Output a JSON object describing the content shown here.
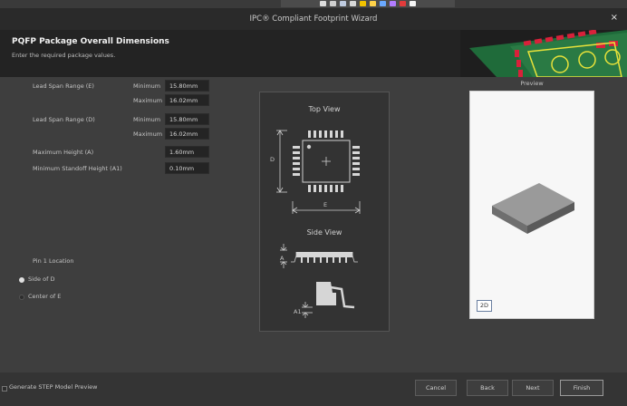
{
  "window": {
    "title": "IPC® Compliant Footprint Wizard",
    "close_label": "×"
  },
  "header": {
    "title": "PQFP Package Overall Dimensions",
    "subtitle": "Enter the required package values."
  },
  "form": {
    "lead_span_e_label": "Lead Span Range (E)",
    "lead_span_d_label": "Lead Span Range (D)",
    "minimum_label": "Minimum",
    "maximum_label": "Maximum",
    "e_min": "15.80mm",
    "e_max": "16.02mm",
    "d_min": "15.80mm",
    "d_max": "16.02mm",
    "max_height_label": "Maximum Height (A)",
    "max_height": "1.60mm",
    "min_standoff_label": "Minimum Standoff Height (A1)",
    "min_standoff": "0.10mm"
  },
  "pin1": {
    "label": "Pin 1 Location",
    "options": [
      "Side of D",
      "Center of E"
    ],
    "selected": "Side of D"
  },
  "diagram": {
    "top_view_label": "Top View",
    "side_view_label": "Side View",
    "dim_d": "D",
    "dim_e": "E",
    "dim_a": "A",
    "dim_a1": "A1"
  },
  "preview": {
    "label": "Preview",
    "view_2d_label": "2D"
  },
  "footer": {
    "generate_step_label": "Generate STEP Model Preview",
    "cancel_label": "Cancel",
    "back_label": "Back",
    "next_label": "Next",
    "finish_label": "Finish"
  },
  "colors": {
    "titlebar": "#2a2a2a",
    "header": "#232323",
    "content": "#3e3e3e",
    "pcb_red": "#d8213a",
    "pcb_green": "#1f6b3a",
    "pcb_yellow": "#e8e23a"
  }
}
